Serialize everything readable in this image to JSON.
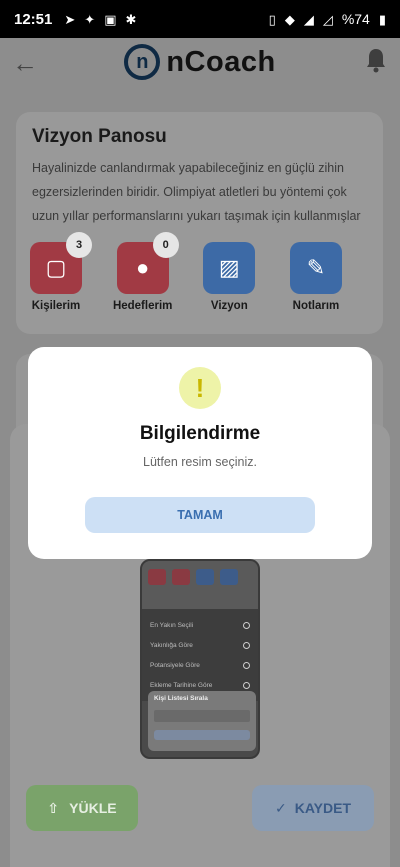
{
  "status_bar": {
    "time": "12:51",
    "battery": "%74",
    "left_icons": [
      "telegram-icon",
      "twitter-icon",
      "image-icon",
      "bug-icon"
    ],
    "right_icons": [
      "vibrate-icon",
      "wifi-icon",
      "signal-icon",
      "signal-x-icon",
      "battery-icon"
    ]
  },
  "header": {
    "logo_mark": "n",
    "logo_text": "nCoach"
  },
  "vision_board": {
    "title": "Vizyon Panosu",
    "description": "Hayalinizde canlandırmak yapabileceğiniz en güçlü zihin egzersizlerinden biridir. Olimpiyat atletleri bu yöntemi çok uzun yıllar performanslarını yukarı taşımak için kullanmışlar",
    "tiles": [
      {
        "label": "Kişilerim",
        "badge": "3",
        "color": "#a13a44"
      },
      {
        "label": "Hedeflerim",
        "badge": "0",
        "color": "#a13a44"
      },
      {
        "label": "Vizyon",
        "badge": "",
        "color": "#3d6aa6"
      },
      {
        "label": "Notlarım",
        "badge": "",
        "color": "#3d6aa6"
      }
    ]
  },
  "phone_preview": {
    "rows": [
      "En Yakın Seçili",
      "Yakınlığa Göre",
      "Potansiyele Göre",
      "Ekleme Tarihine Göre"
    ],
    "sheet_title": "Kişi Listesi Sırala"
  },
  "buttons": {
    "upload": "YÜKLE",
    "save": "KAYDET"
  },
  "dialog": {
    "title": "Bilgilendirme",
    "message": "Lütfen resim seçiniz.",
    "ok": "TAMAM",
    "accent": "#3a6fb0"
  }
}
